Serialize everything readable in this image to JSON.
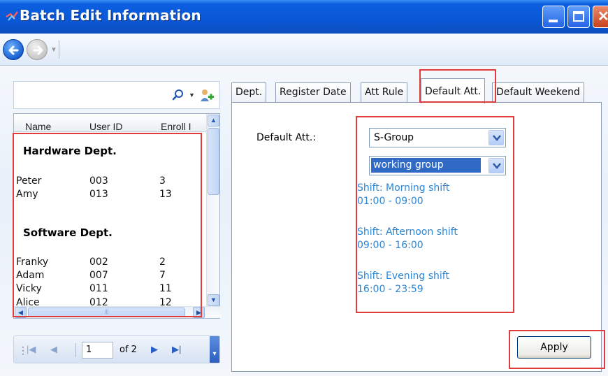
{
  "window": {
    "title": "Batch Edit Information"
  },
  "search": {
    "value": "",
    "placeholder": ""
  },
  "list": {
    "columns": [
      "Name",
      "User ID",
      "Enroll I"
    ],
    "groups": [
      {
        "title": "Hardware Dept.",
        "rows": [
          {
            "name": "Peter",
            "user_id": "003",
            "enroll": "3"
          },
          {
            "name": "Amy",
            "user_id": "013",
            "enroll": "13"
          }
        ]
      },
      {
        "title": "Software Dept.",
        "rows": [
          {
            "name": "Franky",
            "user_id": "002",
            "enroll": "2"
          },
          {
            "name": "Adam",
            "user_id": "007",
            "enroll": "7"
          },
          {
            "name": "Vicky",
            "user_id": "011",
            "enroll": "11"
          },
          {
            "name": "Alice",
            "user_id": "012",
            "enroll": "12"
          }
        ]
      }
    ]
  },
  "pager": {
    "current_page": "1",
    "of_text": "of 2"
  },
  "tabs": [
    {
      "label": "Dept."
    },
    {
      "label": "Register Date"
    },
    {
      "label": "Att Rule"
    },
    {
      "label": "Default Att."
    },
    {
      "label": "Default Weekend"
    }
  ],
  "selected_tab": "Default Att.",
  "default_att": {
    "label": "Default Att.:",
    "group_select": "S-Group",
    "type_select": "working group",
    "shifts": [
      {
        "name": "Shift: Morning shift",
        "time": "01:00 - 09:00"
      },
      {
        "name": "Shift: Afternoon shift",
        "time": "09:00 - 16:00"
      },
      {
        "name": "Shift: Evening shift",
        "time": "16:00 - 23:59"
      }
    ]
  },
  "apply_label": "Apply",
  "colors": {
    "titlebar": "#0a58d6",
    "highlight_box": "#e03c3c",
    "shift_text": "#2c86d6",
    "selection": "#316ac5"
  }
}
